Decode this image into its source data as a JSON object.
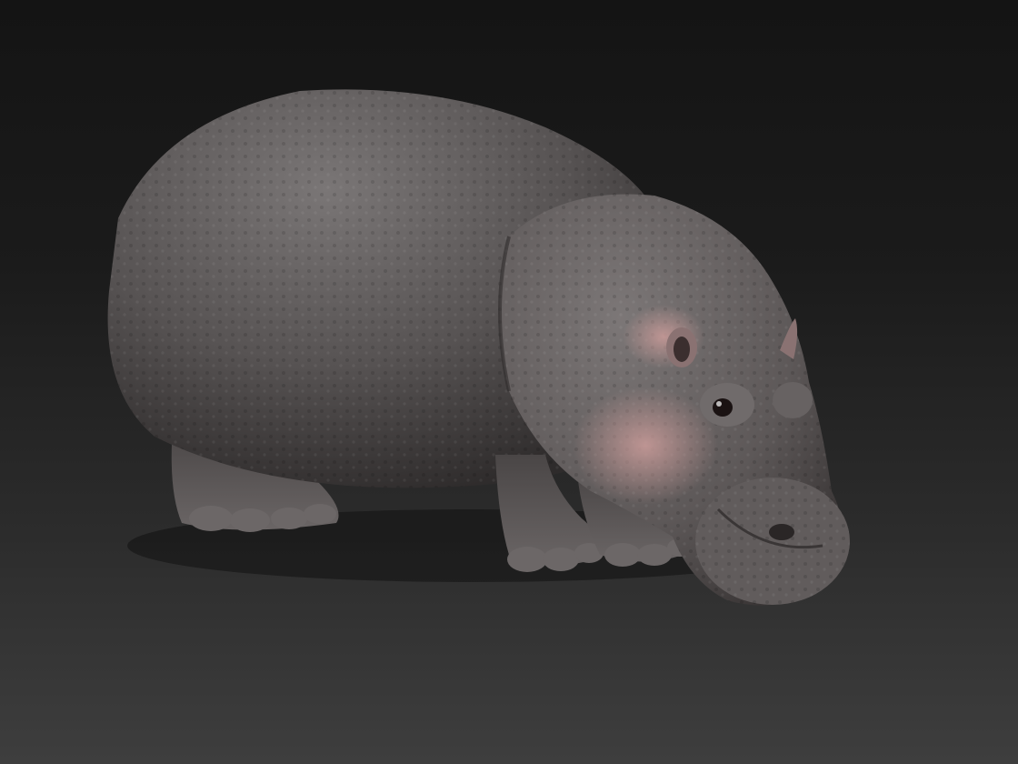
{
  "scene": {
    "subject": "hippopotamus",
    "render_style": "clay sculpt render",
    "background": {
      "top_color": "#141414",
      "bottom_color": "#3e3e3e"
    },
    "colors": {
      "skin_dark": "#3a3737",
      "skin_mid": "#5a5656",
      "skin_light": "#7a7575",
      "skin_pink": "#c79a98",
      "eye": "#1a1212"
    }
  }
}
